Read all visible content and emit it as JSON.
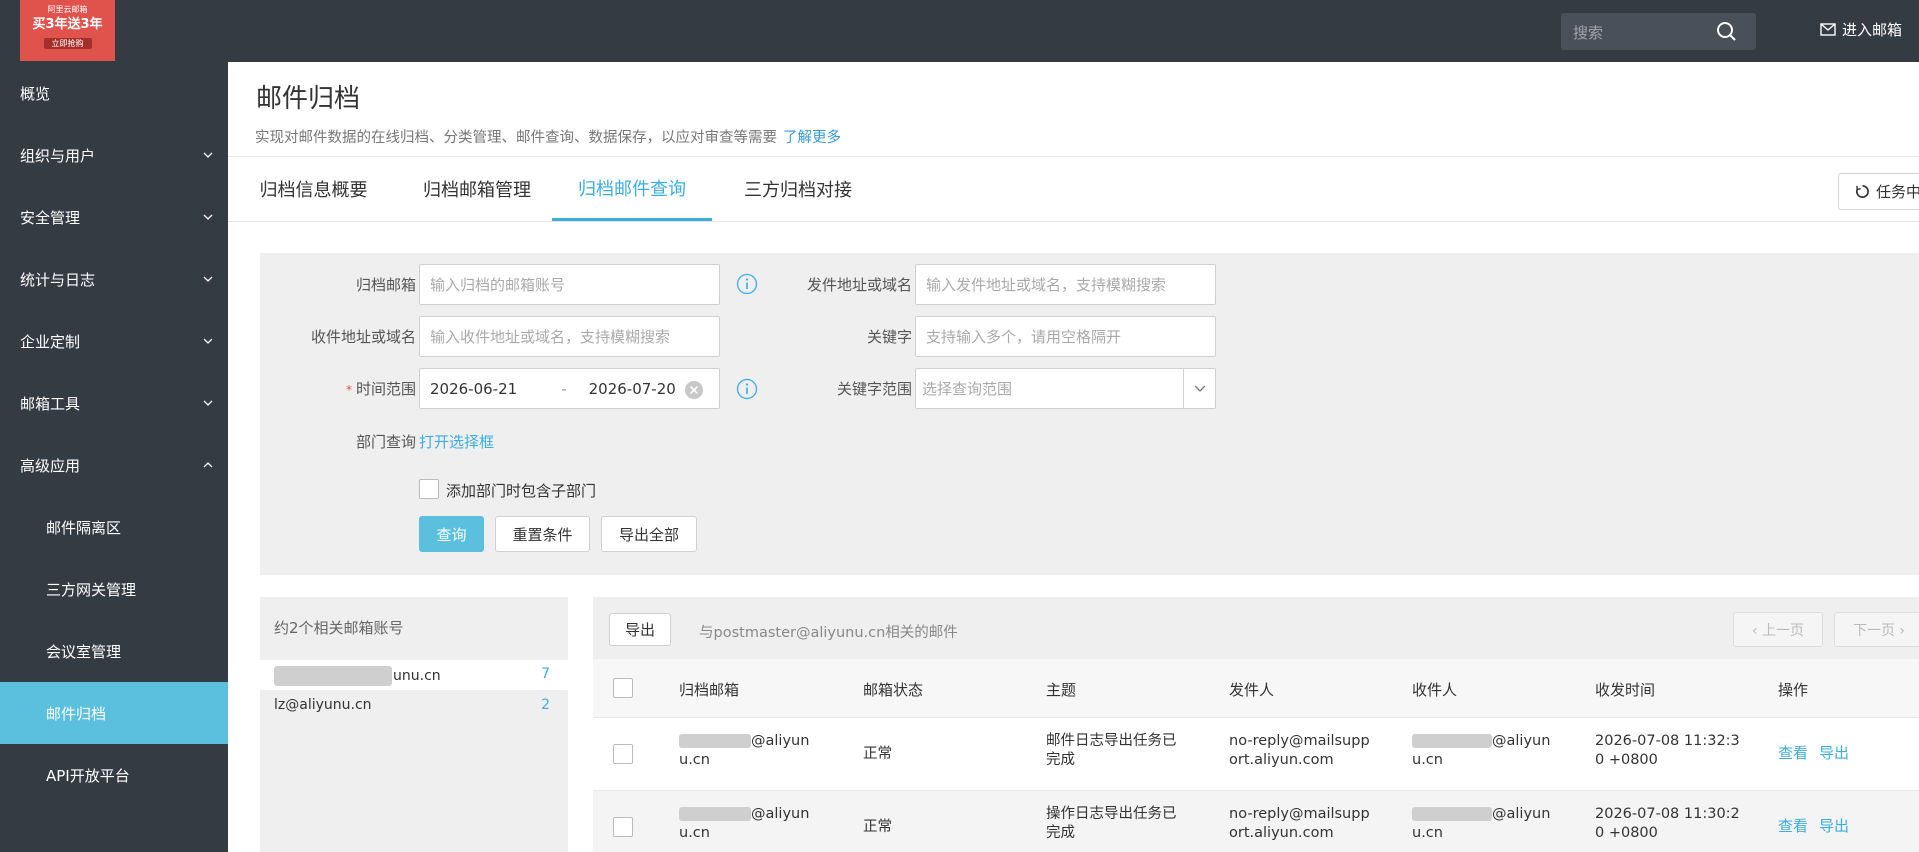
{
  "logo": {
    "line1": "阿里云邮箱",
    "line2": "买3年送3年",
    "line3": "立即抢购"
  },
  "topbar": {
    "search_placeholder": "搜索",
    "enter_mailbox": "进入邮箱"
  },
  "sidebar": {
    "items": [
      {
        "label": "概览"
      },
      {
        "label": "组织与用户"
      },
      {
        "label": "安全管理"
      },
      {
        "label": "统计与日志"
      },
      {
        "label": "企业定制"
      },
      {
        "label": "邮箱工具"
      },
      {
        "label": "高级应用"
      },
      {
        "label": "邮件隔离区"
      },
      {
        "label": "三方网关管理"
      },
      {
        "label": "会议室管理"
      },
      {
        "label": "邮件归档"
      },
      {
        "label": "API开放平台"
      }
    ]
  },
  "page": {
    "title": "邮件归档",
    "desc": "实现对邮件数据的在线归档、分类管理、邮件查询、数据保存，以应对审查等需要",
    "learn_more": "了解更多"
  },
  "tabs": [
    {
      "label": "归档信息概要"
    },
    {
      "label": "归档邮箱管理"
    },
    {
      "label": "归档邮件查询"
    },
    {
      "label": "三方归档对接"
    }
  ],
  "task_button": "任务中心",
  "filter": {
    "archive_mailbox_label": "归档邮箱",
    "archive_mailbox_placeholder": "输入归档的邮箱账号",
    "sender_label": "发件地址或域名",
    "sender_placeholder": "输入发件地址或域名，支持模糊搜索",
    "recipient_label": "收件地址或域名",
    "recipient_placeholder": "输入收件地址或域名，支持模糊搜索",
    "keyword_label": "关键字",
    "keyword_placeholder": "支持输入多个，请用空格隔开",
    "time_label": "时间范围",
    "time_required": "*",
    "date_from": "2026-06-21",
    "date_sep": "-",
    "date_to": "2026-07-20",
    "keyword_scope_label": "关键字范围",
    "keyword_scope_placeholder": "选择查询范围",
    "dept_label": "部门查询",
    "dept_link": "打开选择框",
    "include_sub": "添加部门时包含子部门",
    "query": "查询",
    "reset": "重置条件",
    "export_all": "导出全部"
  },
  "accounts": {
    "header": "约2个相关邮箱账号",
    "items": [
      {
        "account": "unu.cn",
        "count": "7"
      },
      {
        "account": "lz@aliyunu.cn",
        "count": "2"
      }
    ]
  },
  "results": {
    "export": "导出",
    "hint": "与postmaster@aliyunu.cn相关的邮件",
    "prev": "‹ 上一页",
    "next": "下一页 ›",
    "columns": [
      "归档邮箱",
      "邮箱状态",
      "主题",
      "发件人",
      "收件人",
      "收发时间",
      "操作"
    ],
    "rows": [
      {
        "mailbox_a": "@aliyun",
        "mailbox_b": "u.cn",
        "status": "正常",
        "subject_a": "邮件日志导出任务已",
        "subject_b": "完成",
        "sender_a": "no-reply@mailsupp",
        "sender_b": "ort.aliyun.com",
        "recipient_a": "@aliyun",
        "recipient_b": "u.cn",
        "time_a": "2026-07-08 11:32:3",
        "time_b": "0 +0800",
        "view": "查看",
        "export": "导出"
      },
      {
        "mailbox_a": "@aliyun",
        "mailbox_b": "u.cn",
        "status": "正常",
        "subject_a": "操作日志导出任务已",
        "subject_b": "完成",
        "sender_a": "no-reply@mailsupp",
        "sender_b": "ort.aliyun.com",
        "recipient_a": "@aliyun",
        "recipient_b": "u.cn",
        "time_a": "2026-07-08 11:30:2",
        "time_b": "0 +0800",
        "view": "查看",
        "export": "导出"
      }
    ]
  },
  "colors": {
    "sidebar_bg": "#353b43",
    "accent": "#5bc0de",
    "link": "#3aaee0",
    "logo_bg": "#e0524c"
  }
}
